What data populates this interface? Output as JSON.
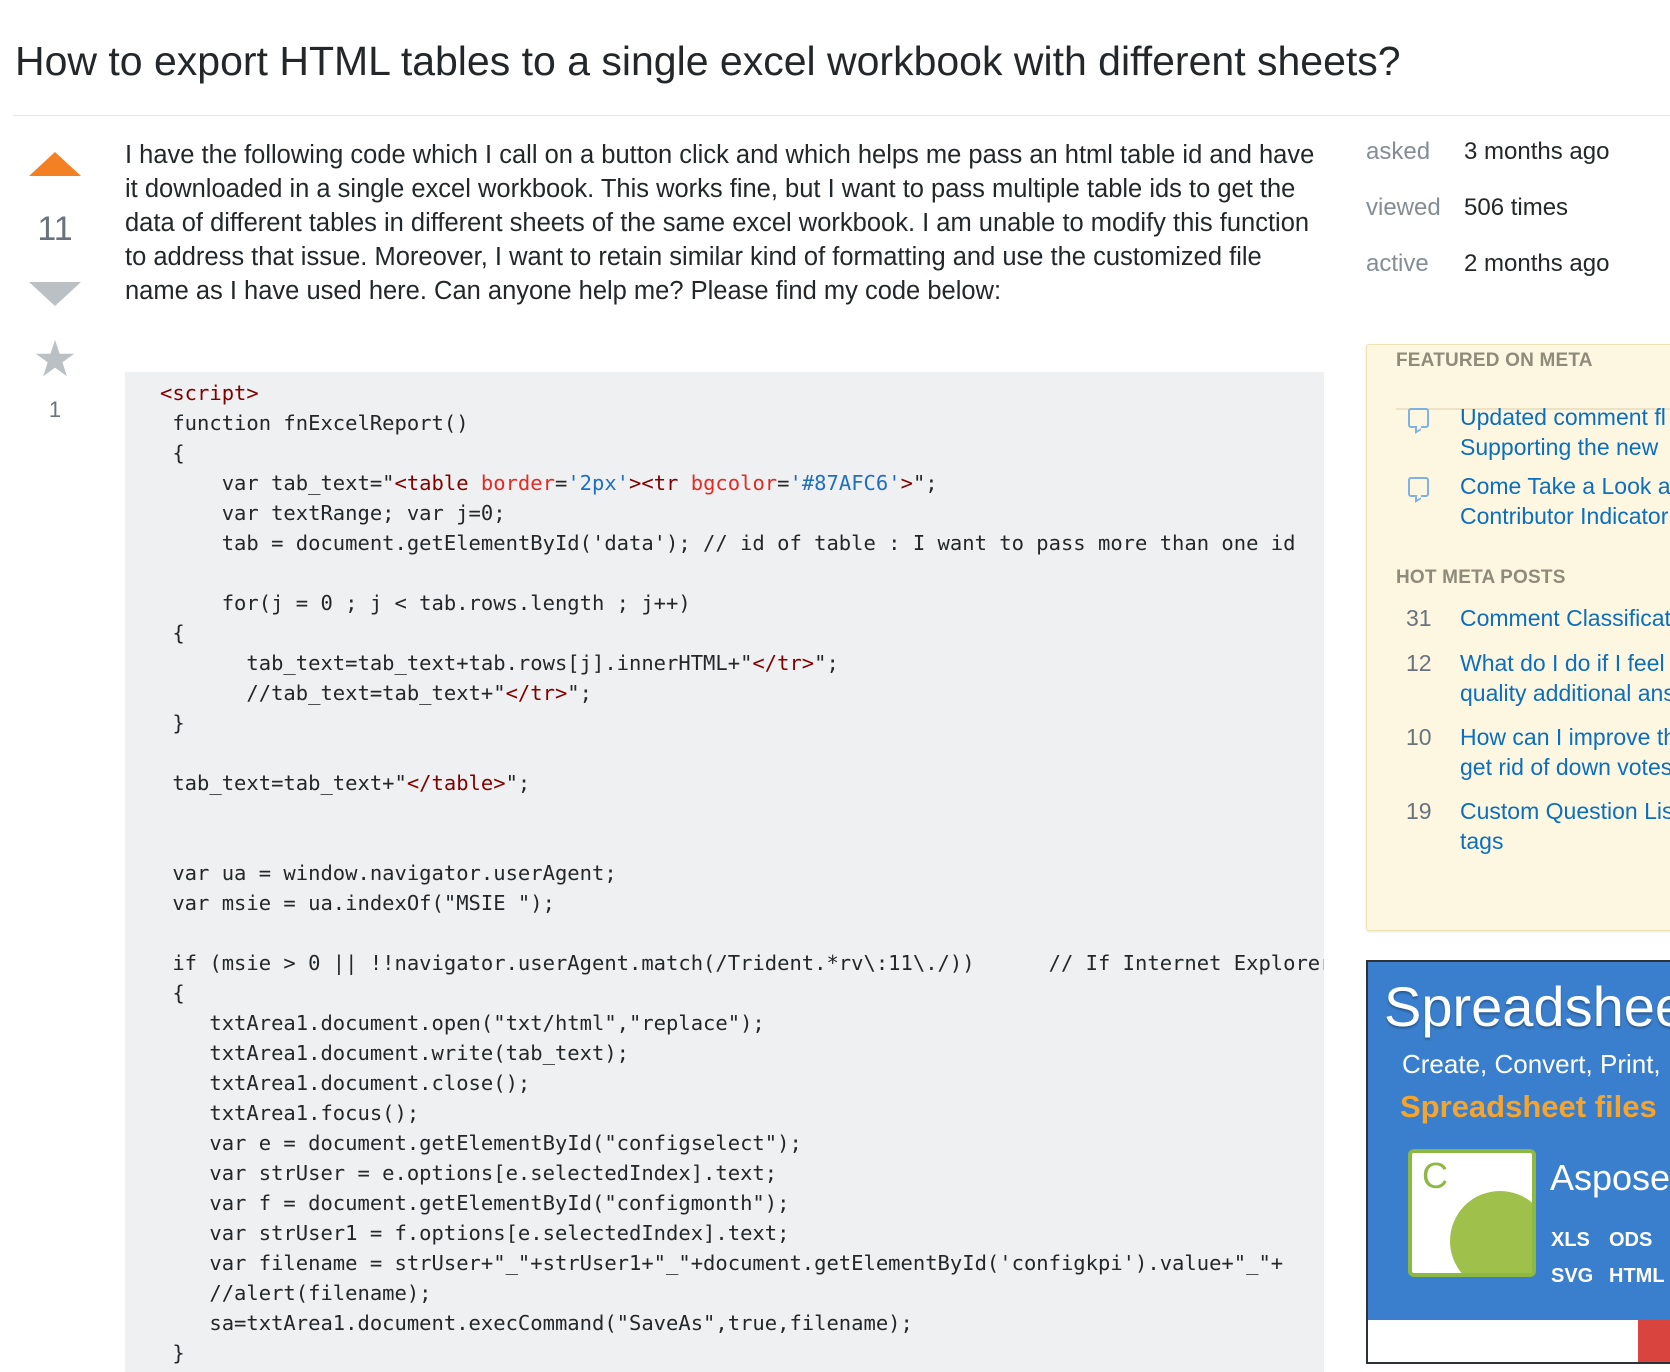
{
  "question": {
    "title": "How to export HTML tables to a single excel workbook with different sheets?",
    "score": "11",
    "favorite_count": "1",
    "body": "I have the following code which I call on a button click and which helps me pass an html table id and have it downloaded in a single excel workbook. This works fine, but I want to pass multiple table ids to get the data of different tables in different sheets of the same excel workbook. I am unable to modify this function to address that issue. Moreover, I want to retain similar kind of formatting and use the customized file name as I have used here. Can anyone help me? Please find my code below:",
    "code_lines": [
      [
        [
          "tag",
          "<script>"
        ]
      ],
      [
        [
          "t",
          " function fnExcelReport()"
        ]
      ],
      [
        [
          "t",
          " {"
        ]
      ],
      [
        [
          "t",
          "     var tab_text=\""
        ],
        [
          "tag",
          "<table "
        ],
        [
          "attr",
          "border"
        ],
        [
          "t",
          "="
        ],
        [
          "val",
          "'2px'"
        ],
        [
          "tag",
          "><tr "
        ],
        [
          "attr",
          "bgcolor"
        ],
        [
          "t",
          "="
        ],
        [
          "val",
          "'#87AFC6'"
        ],
        [
          "tag",
          ">"
        ],
        [
          "t",
          "\";"
        ]
      ],
      [
        [
          "t",
          "     var textRange; var j=0;"
        ]
      ],
      [
        [
          "t",
          "     tab = document.getElementById('data'); // id of table : I want to pass more than one id"
        ]
      ],
      [
        [
          "t",
          ""
        ]
      ],
      [
        [
          "t",
          "     for(j = 0 ; j < tab.rows.length ; j++)"
        ]
      ],
      [
        [
          "t",
          " {"
        ]
      ],
      [
        [
          "t",
          "       tab_text=tab_text+tab.rows[j].innerHTML+\""
        ],
        [
          "tag",
          "</tr>"
        ],
        [
          "t",
          "\";"
        ]
      ],
      [
        [
          "t",
          "       //tab_text=tab_text+\""
        ],
        [
          "tag",
          "</tr>"
        ],
        [
          "t",
          "\";"
        ]
      ],
      [
        [
          "t",
          " }"
        ]
      ],
      [
        [
          "t",
          ""
        ]
      ],
      [
        [
          "t",
          " tab_text=tab_text+\""
        ],
        [
          "tag",
          "</table>"
        ],
        [
          "t",
          "\";"
        ]
      ],
      [
        [
          "t",
          ""
        ]
      ],
      [
        [
          "t",
          ""
        ]
      ],
      [
        [
          "t",
          " var ua = window.navigator.userAgent;"
        ]
      ],
      [
        [
          "t",
          " var msie = ua.indexOf(\"MSIE \");"
        ]
      ],
      [
        [
          "t",
          ""
        ]
      ],
      [
        [
          "t",
          " if (msie > 0 || !!navigator.userAgent.match(/Trident.*rv\\:11\\./))      // If Internet Explorer"
        ]
      ],
      [
        [
          "t",
          " {"
        ]
      ],
      [
        [
          "t",
          "    txtArea1.document.open(\"txt/html\",\"replace\");"
        ]
      ],
      [
        [
          "t",
          "    txtArea1.document.write(tab_text);"
        ]
      ],
      [
        [
          "t",
          "    txtArea1.document.close();"
        ]
      ],
      [
        [
          "t",
          "    txtArea1.focus();"
        ]
      ],
      [
        [
          "t",
          "    var e = document.getElementById(\"configselect\");"
        ]
      ],
      [
        [
          "t",
          "    var strUser = e.options[e.selectedIndex].text;"
        ]
      ],
      [
        [
          "t",
          "    var f = document.getElementById(\"configmonth\");"
        ]
      ],
      [
        [
          "t",
          "    var strUser1 = f.options[e.selectedIndex].text;"
        ]
      ],
      [
        [
          "t",
          "    var filename = strUser+\"_\"+strUser1+\"_\"+document.getElementById('configkpi').value+\"_\"+"
        ]
      ],
      [
        [
          "t",
          "    //alert(filename);"
        ]
      ],
      [
        [
          "t",
          "    sa=txtArea1.document.execCommand(\"SaveAs\",true,filename);"
        ]
      ],
      [
        [
          "t",
          " }"
        ]
      ]
    ]
  },
  "stats": [
    {
      "label": "asked",
      "value": "3 months ago"
    },
    {
      "label": "viewed",
      "value": "506 times"
    },
    {
      "label": "active",
      "value": "2 months ago"
    }
  ],
  "featured_meta": {
    "heading": "FEATURED ON META",
    "items": [
      {
        "icon": "comment-bubble-icon",
        "lines": [
          "Updated comment fl",
          "Supporting the new"
        ]
      },
      {
        "icon": "comment-bubble-icon",
        "lines": [
          "Come Take a Look a",
          "Contributor Indicator"
        ]
      }
    ]
  },
  "hot_meta": {
    "heading": "HOT META POSTS",
    "items": [
      {
        "score": "31",
        "lines": [
          "Comment Classificat"
        ]
      },
      {
        "score": "12",
        "lines": [
          "What do I do if I feel",
          "quality additional ans"
        ]
      },
      {
        "score": "10",
        "lines": [
          "How can I improve th",
          "get rid of down votes"
        ]
      },
      {
        "score": "19",
        "lines": [
          "Custom Question Lis",
          "tags"
        ]
      }
    ]
  },
  "ad": {
    "headline": "Spreadsheet",
    "subline": "Create, Convert, Print,",
    "highlight": "Spreadsheet files",
    "logo_letter": "C",
    "product": "Aspose.",
    "formats": [
      "XLS",
      "ODS",
      "SVG",
      "HTML"
    ],
    "colors": {
      "background": "#3a7fcd",
      "highlight": "#f6a42a",
      "logo": "#8db842"
    }
  },
  "colors": {
    "upvote": "#f48024",
    "link": "#0c6ebd",
    "meta_bg": "#fdf7e2",
    "code_bg": "#eff0f1"
  }
}
